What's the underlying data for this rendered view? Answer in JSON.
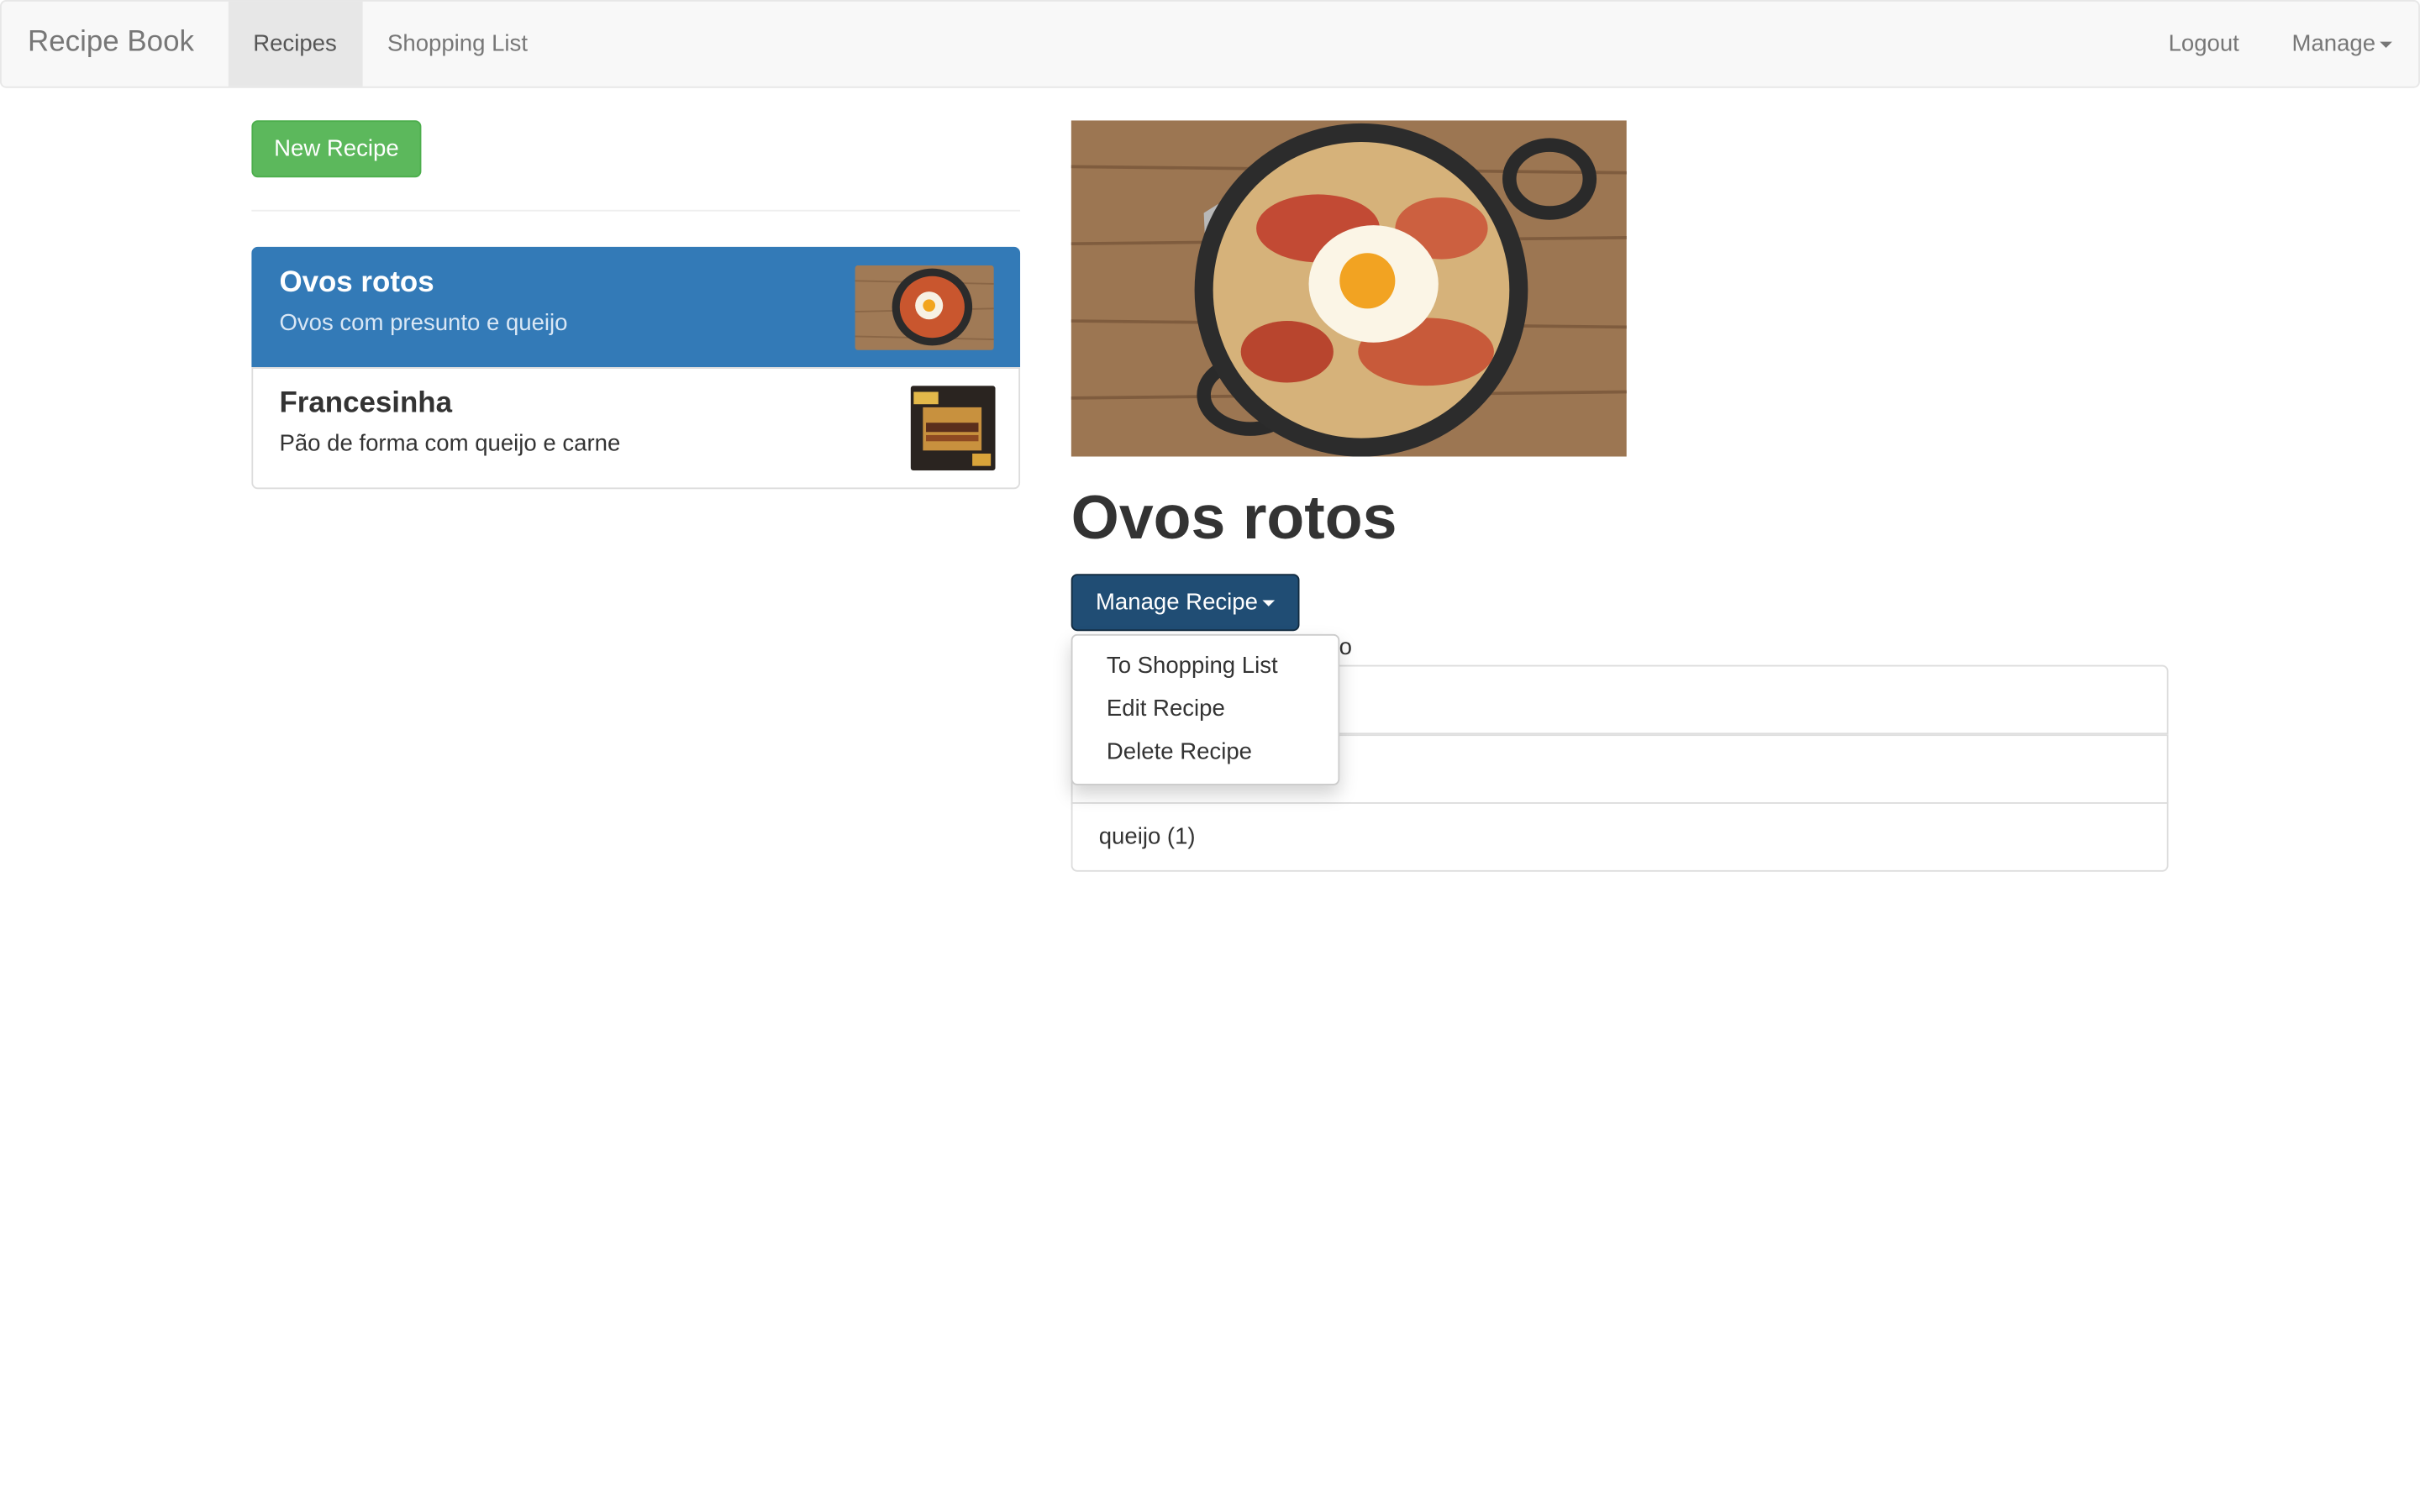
{
  "navbar": {
    "brand": "Recipe Book",
    "tabs": [
      {
        "label": "Recipes",
        "active": true
      },
      {
        "label": "Shopping List",
        "active": false
      }
    ],
    "logout_label": "Logout",
    "manage_label": "Manage"
  },
  "sidebar": {
    "new_recipe_label": "New Recipe",
    "recipes": [
      {
        "name": "Ovos rotos",
        "description": "Ovos com presunto e queijo",
        "active": true
      },
      {
        "name": "Francesinha",
        "description": "Pão de forma com queijo e carne",
        "active": false
      }
    ]
  },
  "detail": {
    "title": "Ovos rotos",
    "manage_button_label": "Manage Recipe",
    "description_visible_fragment": "ijo",
    "ingredients": [
      "",
      "",
      "queijo (1)"
    ],
    "dropdown": {
      "items": [
        "To Shopping List",
        "Edit Recipe",
        "Delete Recipe"
      ]
    }
  },
  "colors": {
    "navbar_bg": "#f8f8f8",
    "success": "#5cb85c",
    "primary_active": "#337ab7",
    "manage_button": "#204d74"
  }
}
